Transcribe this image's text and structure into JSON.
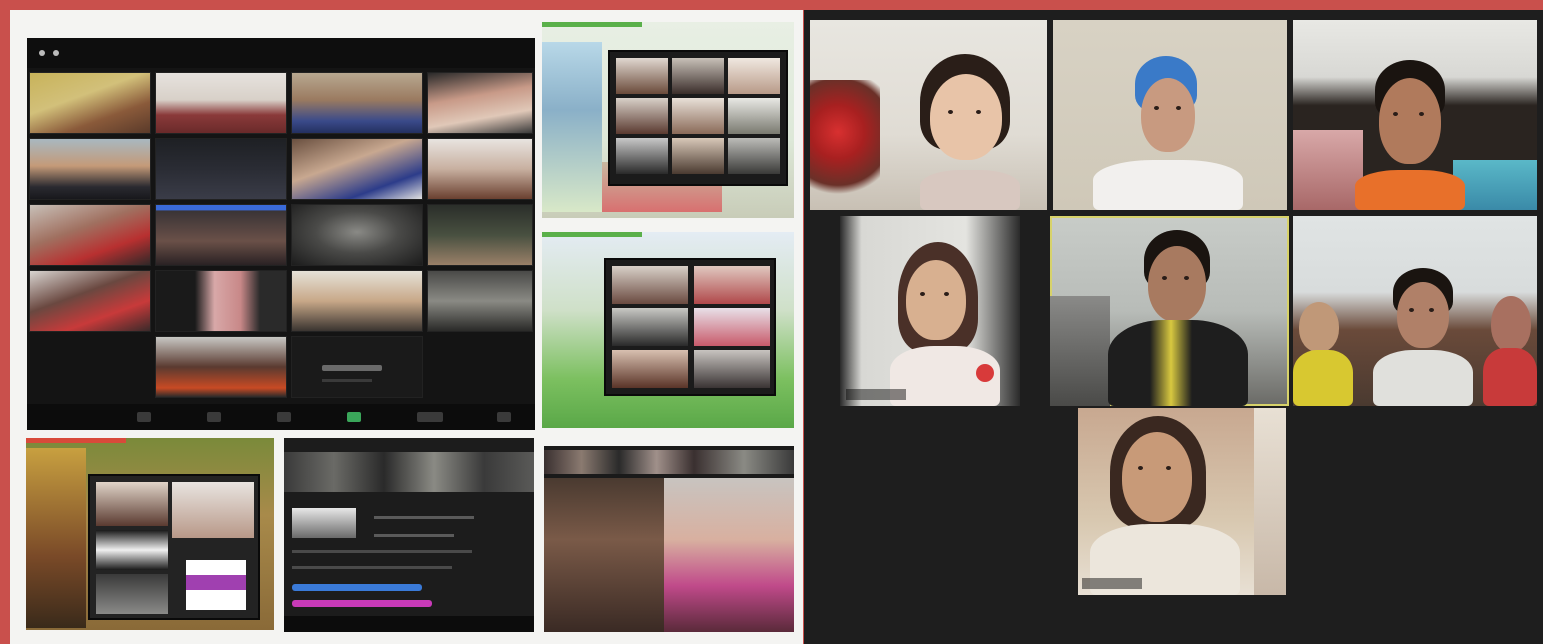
{
  "collage": {
    "left_panel": {
      "main_screenshot": {
        "tiles": 19,
        "active_speaker_index": -1
      },
      "slides": [
        "slide-top-right",
        "slide-mid-right",
        "slide-bottom-left",
        "slide-bottom-center",
        "slide-bottom-right"
      ]
    },
    "right_panel": {
      "grid_tiles": 7,
      "active_tile": "right-tile-5"
    }
  },
  "colors": {
    "frame_border": "#c9504c",
    "left_background": "#f4f4f2",
    "right_background": "#1e1e1e",
    "active_speaker_outline": "#d7d26a"
  }
}
